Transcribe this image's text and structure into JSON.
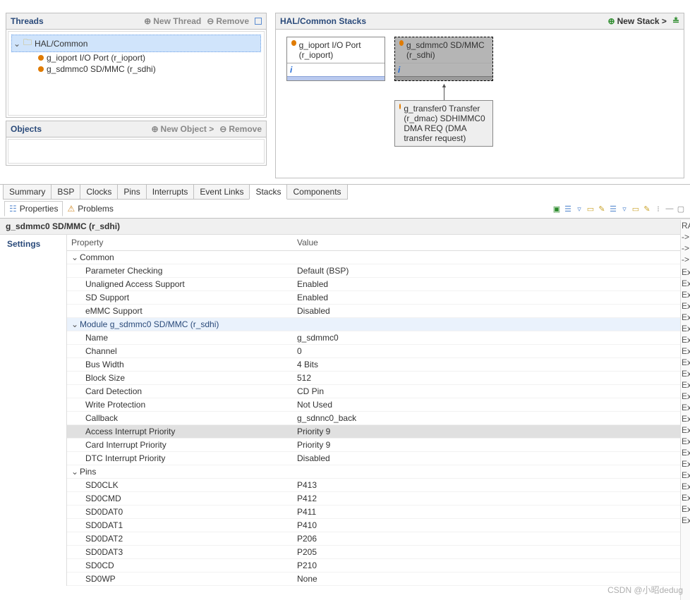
{
  "threads_panel": {
    "title": "Threads",
    "new_thread": "New Thread",
    "remove": "Remove",
    "root": "HAL/Common",
    "items": [
      "g_ioport I/O Port (r_ioport)",
      "g_sdmmc0 SD/MMC (r_sdhi)"
    ]
  },
  "objects_panel": {
    "title": "Objects",
    "new_object": "New Object >",
    "remove": "Remove"
  },
  "stacks_panel": {
    "title": "HAL/Common Stacks",
    "new_stack": "New Stack >",
    "box_ioport": "g_ioport I/O Port (r_ioport)",
    "box_sdmmc": "g_sdmmc0 SD/MMC (r_sdhi)",
    "box_transfer": "g_transfer0 Transfer (r_dmac) SDHIMMC0 DMA REQ (DMA transfer request)"
  },
  "tabs": {
    "t0": "Summary",
    "t1": "BSP",
    "t2": "Clocks",
    "t3": "Pins",
    "t4": "Interrupts",
    "t5": "Event Links",
    "t6": "Stacks",
    "t7": "Components"
  },
  "views": {
    "properties": "Properties",
    "problems": "Problems"
  },
  "prop_title": "g_sdmmc0 SD/MMC (r_sdhi)",
  "prop_sidebar": {
    "settings": "Settings"
  },
  "prop_head": {
    "k": "Property",
    "v": "Value"
  },
  "groups": {
    "common": "Common",
    "module": "Module g_sdmmc0 SD/MMC (r_sdhi)",
    "pins": "Pins"
  },
  "rows": {
    "param_check": {
      "k": "Parameter Checking",
      "v": "Default (BSP)"
    },
    "unaligned": {
      "k": "Unaligned Access Support",
      "v": "Enabled"
    },
    "sd_support": {
      "k": "SD Support",
      "v": "Enabled"
    },
    "emmc_support": {
      "k": "eMMC Support",
      "v": "Disabled"
    },
    "name": {
      "k": "Name",
      "v": "g_sdmmc0"
    },
    "channel": {
      "k": "Channel",
      "v": "0"
    },
    "bus_width": {
      "k": "Bus Width",
      "v": "4 Bits"
    },
    "block_size": {
      "k": "Block Size",
      "v": "512"
    },
    "card_detect": {
      "k": "Card Detection",
      "v": "CD Pin"
    },
    "write_prot": {
      "k": "Write Protection",
      "v": "Not Used"
    },
    "callback": {
      "k": "Callback",
      "v": "g_sdnnc0_back"
    },
    "access_int": {
      "k": "Access Interrupt Priority",
      "v": "Priority 9"
    },
    "card_int": {
      "k": "Card Interrupt Priority",
      "v": "Priority 9"
    },
    "dtc_int": {
      "k": "DTC Interrupt Priority",
      "v": "Disabled"
    },
    "sd0clk": {
      "k": "SD0CLK",
      "v": "P413"
    },
    "sd0cmd": {
      "k": "SD0CMD",
      "v": "P412"
    },
    "sd0dat0": {
      "k": "SD0DAT0",
      "v": "P411"
    },
    "sd0dat1": {
      "k": "SD0DAT1",
      "v": "P410"
    },
    "sd0dat2": {
      "k": "SD0DAT2",
      "v": "P206"
    },
    "sd0dat3": {
      "k": "SD0DAT3",
      "v": "P205"
    },
    "sd0cd": {
      "k": "SD0CD",
      "v": "P210"
    },
    "sd0wp": {
      "k": "SD0WP",
      "v": "None"
    }
  },
  "right": {
    "r0": "RA",
    "r1": "->",
    "r2": "->",
    "r3": "->",
    "r4": "",
    "r5": "Ex",
    "r6": "Ex",
    "r7": "Ex",
    "r8": "Ex",
    "r9": "Ex",
    "r10": "Ex",
    "r11": "Ex",
    "r12": "Ex",
    "r13": "Ex",
    "r14": "Ex",
    "r15": "Ex",
    "r16": "Ex",
    "r17": "Ex",
    "r18": "Ex",
    "r19": "Ex",
    "r20": "Ex",
    "r21": "Ex",
    "r22": "Ex",
    "r23": "Ex",
    "r24": "Ex",
    "r25": "Ex",
    "r26": "Ex",
    "r27": "Ex"
  },
  "watermark": "CSDN @小昭dedug"
}
